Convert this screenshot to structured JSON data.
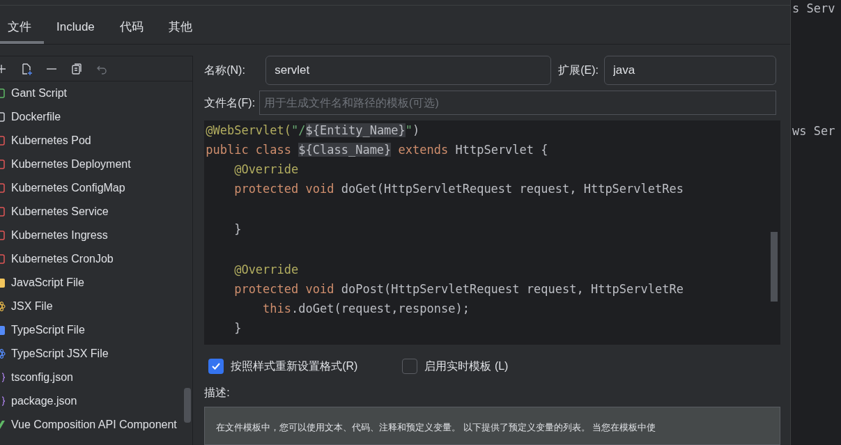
{
  "tabs": [
    {
      "label": "文件",
      "selected": true
    },
    {
      "label": "Include",
      "selected": false
    },
    {
      "label": "代码",
      "selected": false
    },
    {
      "label": "其他",
      "selected": false
    }
  ],
  "toolbar": [
    {
      "kind": "add",
      "disabled": false
    },
    {
      "kind": "new-file",
      "disabled": false
    },
    {
      "kind": "remove",
      "disabled": false
    },
    {
      "kind": "copy",
      "disabled": false
    },
    {
      "kind": "undo",
      "disabled": true
    }
  ],
  "templates": [
    {
      "label": "Gant Script",
      "kind": "gant"
    },
    {
      "label": "Dockerfile",
      "kind": "docker"
    },
    {
      "label": "Kubernetes Pod",
      "kind": "k8s"
    },
    {
      "label": "Kubernetes Deployment",
      "kind": "k8s"
    },
    {
      "label": "Kubernetes ConfigMap",
      "kind": "k8s"
    },
    {
      "label": "Kubernetes Service",
      "kind": "k8s"
    },
    {
      "label": "Kubernetes Ingress",
      "kind": "k8s"
    },
    {
      "label": "Kubernetes CronJob",
      "kind": "k8s"
    },
    {
      "label": "JavaScript File",
      "kind": "js"
    },
    {
      "label": "JSX File",
      "kind": "jsx"
    },
    {
      "label": "TypeScript File",
      "kind": "ts"
    },
    {
      "label": "TypeScript JSX File",
      "kind": "tsx"
    },
    {
      "label": "tsconfig.json",
      "kind": "json"
    },
    {
      "label": "package.json",
      "kind": "json"
    },
    {
      "label": "Vue Composition API Component",
      "kind": "vue"
    }
  ],
  "name_field": {
    "label": "名称(N):",
    "value": "servlet"
  },
  "extension_field": {
    "label": "扩展(E):",
    "value": "java"
  },
  "filename_field": {
    "label": "文件名(F):",
    "placeholder": "用于生成文件名和路径的模板(可选)"
  },
  "code_lines": [
    {
      "kind": "code",
      "tokens": [
        {
          "kind": "annotation",
          "text": "@WebServlet("
        },
        {
          "kind": "string",
          "text": "\"/"
        },
        {
          "kind": "var",
          "text": "${Entity_Name}"
        },
        {
          "kind": "string",
          "text": "\""
        },
        {
          "kind": "plain",
          "text": ")"
        }
      ]
    },
    {
      "kind": "code",
      "tokens": [
        {
          "kind": "keyword",
          "text": "public class "
        },
        {
          "kind": "var",
          "text": "${Class_Name}"
        },
        {
          "kind": "keyword",
          "text": " extends "
        },
        {
          "kind": "plain",
          "text": "HttpServlet {"
        }
      ]
    },
    {
      "kind": "code",
      "tokens": [
        {
          "kind": "annotation",
          "text": "    @Override"
        }
      ]
    },
    {
      "kind": "code",
      "tokens": [
        {
          "kind": "keyword",
          "text": "    protected void "
        },
        {
          "kind": "plain",
          "text": "doGet(HttpServletRequest request, HttpServletRes"
        }
      ]
    },
    {
      "kind": "blank"
    },
    {
      "kind": "code",
      "tokens": [
        {
          "kind": "plain",
          "text": "    }"
        }
      ]
    },
    {
      "kind": "blank"
    },
    {
      "kind": "code",
      "tokens": [
        {
          "kind": "annotation",
          "text": "    @Override"
        }
      ]
    },
    {
      "kind": "code",
      "tokens": [
        {
          "kind": "keyword",
          "text": "    protected void "
        },
        {
          "kind": "plain",
          "text": "doPost(HttpServletRequest request, HttpServletRe"
        }
      ]
    },
    {
      "kind": "code",
      "tokens": [
        {
          "kind": "keyword",
          "text": "        this"
        },
        {
          "kind": "plain",
          "text": ".doGet(request,response);"
        }
      ]
    },
    {
      "kind": "code",
      "tokens": [
        {
          "kind": "plain",
          "text": "    }"
        }
      ]
    }
  ],
  "options": [
    {
      "label": "按照样式重新设置格式(R)",
      "checked": true
    },
    {
      "label": "启用实时模板 (L)",
      "checked": false
    }
  ],
  "description": {
    "label": "描述:",
    "text": "在文件模板中，您可以使用文本、代码、注释和预定义变量。 以下提供了预定义变量的列表。 当您在模板中使"
  },
  "background_editor": [
    "s Serv",
    "ws Ser"
  ]
}
